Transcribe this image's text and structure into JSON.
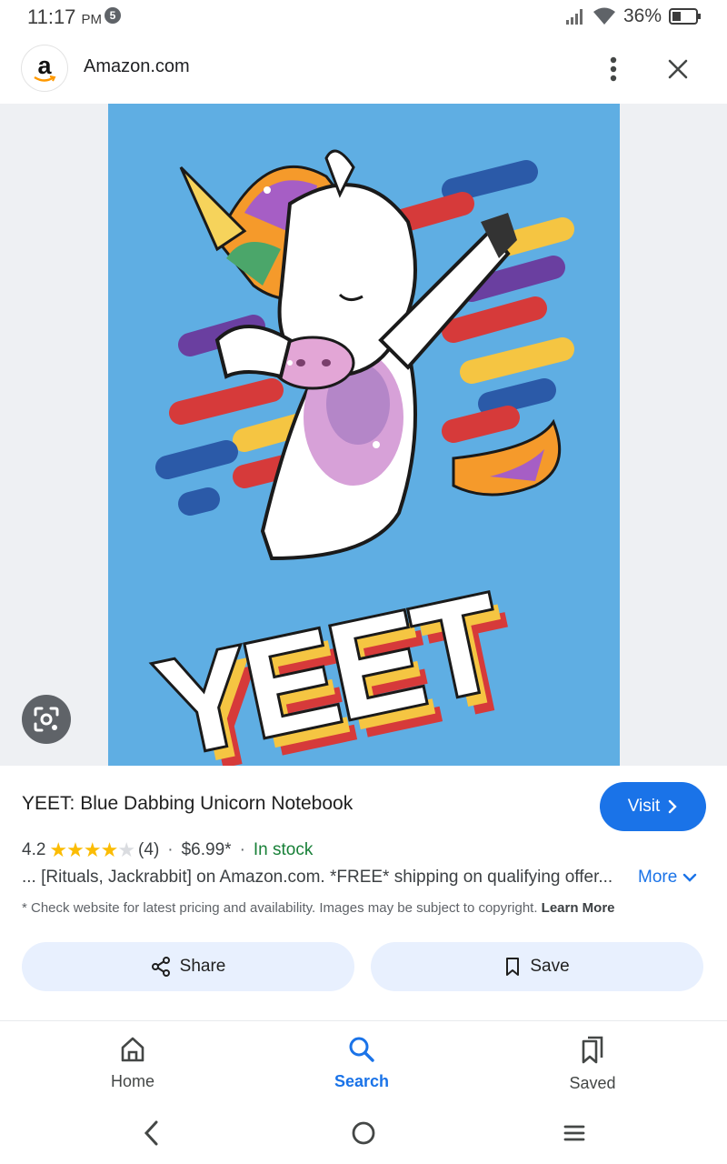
{
  "status_bar": {
    "time": "11:17",
    "ampm": "PM",
    "notification_count": "5",
    "battery": "36%"
  },
  "header": {
    "site_logo_letter": "a",
    "site_name": "Amazon.com"
  },
  "image": {
    "artwork_text": "YEET",
    "background_color": "#5faee3"
  },
  "product": {
    "title": "YEET: Blue Dabbing Unicorn Notebook",
    "visit_label": "Visit",
    "rating": "4.2",
    "rating_stars": 4.2,
    "review_count": "(4)",
    "price": "$6.99*",
    "stock": "In stock",
    "snippet": "... [Rituals, Jackrabbit] on Amazon.com. *FREE* shipping on qualifying offer...",
    "more_label": "More",
    "disclaimer": "* Check website for latest pricing and availability. Images may be subject to copyright.",
    "learn_more": "Learn More"
  },
  "actions": {
    "share": "Share",
    "save": "Save"
  },
  "bottom_nav": {
    "home": "Home",
    "search": "Search",
    "saved": "Saved"
  },
  "colors": {
    "accent": "#1a73e8",
    "stock_green": "#188038",
    "star": "#fbbc04"
  }
}
